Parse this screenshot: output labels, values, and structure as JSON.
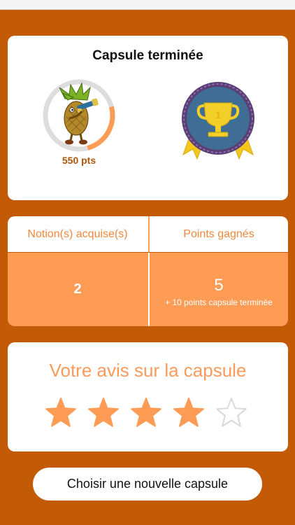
{
  "summary": {
    "title": "Capsule terminée",
    "points": "550 pts",
    "progress": 0.25,
    "medal_rank": "1"
  },
  "stats": {
    "notions_label": "Notion(s) acquise(s)",
    "notions_value": "2",
    "points_label": "Points gagnés",
    "points_value": "5",
    "points_bonus": "+ 10 points capsule terminée"
  },
  "rating": {
    "title": "Votre avis sur la capsule",
    "value": 4,
    "max": 5
  },
  "actions": {
    "new_capsule_label": "Choisir une nouvelle capsule"
  },
  "colors": {
    "background": "#c25a06",
    "accent": "#fe9c56",
    "accent_text": "#f2873b",
    "star_filled": "#fe9c56",
    "star_empty": "#d9d9d9"
  },
  "icons": {
    "avatar": "pineapple-explorer-telescope-icon",
    "medal": "trophy-medal-icon",
    "star": "star-icon"
  }
}
